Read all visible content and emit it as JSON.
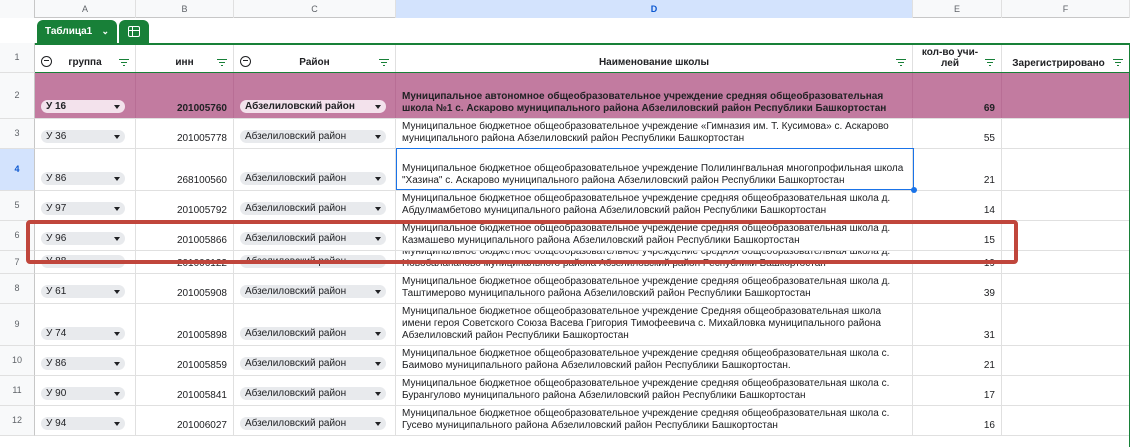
{
  "column_letters": [
    "A",
    "B",
    "C",
    "D",
    "E",
    "F"
  ],
  "selected_column": "D",
  "row_numbers": [
    "1",
    "2",
    "3",
    "4",
    "5",
    "6",
    "7",
    "8",
    "9",
    "10",
    "11",
    "12"
  ],
  "selected_row": "4",
  "table_tab": {
    "name": "Таблица1"
  },
  "headers": {
    "group": "группа",
    "inn": "инн",
    "district": "Район",
    "school": "Наименование школы",
    "teachers": "кол-во учи-лей",
    "registered": "Зарегистрировано"
  },
  "rows": [
    {
      "group": "У 16",
      "inn": "201005760",
      "district": "Абзелиловский район",
      "school": "Муниципальное автономное общеобразовательное учреждение средняя общеобразовательная школа №1 с. Аскарово муниципального района Абзелиловский район Республики Башкортостан",
      "teachers": "69",
      "highlight": true
    },
    {
      "group": "У 36",
      "inn": "201005778",
      "district": "Абзелиловский район",
      "school": "Муниципальное бюджетное общеобразовательное учреждение «Гимназия им. Т. Кусимова» с. Аскарово муниципального района Абзелиловский район Республики Башкортостан",
      "teachers": "55"
    },
    {
      "group": "У 86",
      "inn": "268100560",
      "district": "Абзелиловский район",
      "school": "Муниципальное бюджетное общеобразовательное учреждение Полилингвальная многопрофильная школа \"Хазина\" с. Аскарово муниципального района Абзелиловский район Республики Башкортостан",
      "teachers": "21"
    },
    {
      "group": "У 97",
      "inn": "201005792",
      "district": "Абзелиловский район",
      "school": "Муниципальное бюджетное общеобразовательное учреждение средняя общеобразовательная школа д. Абдулмамбетово муниципального района Абзелиловский район Республики Башкортостан",
      "teachers": "14"
    },
    {
      "group": "У 96",
      "inn": "201005866",
      "district": "Абзелиловский район",
      "school": "Муниципальное бюджетное общеобразовательное учреждение средняя общеобразовательная школа д. Казмашево муниципального района Абзелиловский район Республики Башкортостан",
      "teachers": "15"
    },
    {
      "group": "У 88",
      "inn": "201006122",
      "district": "Абзелиловский район",
      "school": "Муниципальное бюджетное общеобразовательное учреждение средняя общеобразовательная школа д. Новобалапаново муниципального района Абзелиловский район Республики Башкортостан",
      "teachers": "19"
    },
    {
      "group": "У 61",
      "inn": "201005908",
      "district": "Абзелиловский район",
      "school": "Муниципальное бюджетное общеобразовательное учреждение средняя общеобразовательная школа д. Таштимерово муниципального района Абзелиловский район Республики Башкортостан",
      "teachers": "39"
    },
    {
      "group": "У 74",
      "inn": "201005898",
      "district": "Абзелиловский район",
      "school": "Муниципальное бюджетное общеобразовательное учреждение Средняя общеобразовательная школа имени героя Советского Союза Васева Григория Тимофеевича с. Михайловка муниципального района Абзелиловский район Республики Башкортостан",
      "teachers": "31"
    },
    {
      "group": "У 86",
      "inn": "201005859",
      "district": "Абзелиловский район",
      "school": "Муниципальное бюджетное общеобразовательное учреждение средняя общеобразовательная школа с. Баимово муниципального района Абзелиловский район Республики Башкортостан.",
      "teachers": "21"
    },
    {
      "group": "У 90",
      "inn": "201005841",
      "district": "Абзелиловский район",
      "school": "Муниципальное бюджетное общеобразовательное учреждение средняя общеобразовательная школа с. Бурангулово муниципального района Абзелиловский район Республики Башкортостан",
      "teachers": "17"
    },
    {
      "group": "У 94",
      "inn": "201006027",
      "district": "Абзелиловский район",
      "school": "Муниципальное бюджетное общеобразовательное учреждение средняя общеобразовательная школа с. Гусево муниципального района Абзелиловский район Республики Башкортостан",
      "teachers": "16"
    }
  ]
}
